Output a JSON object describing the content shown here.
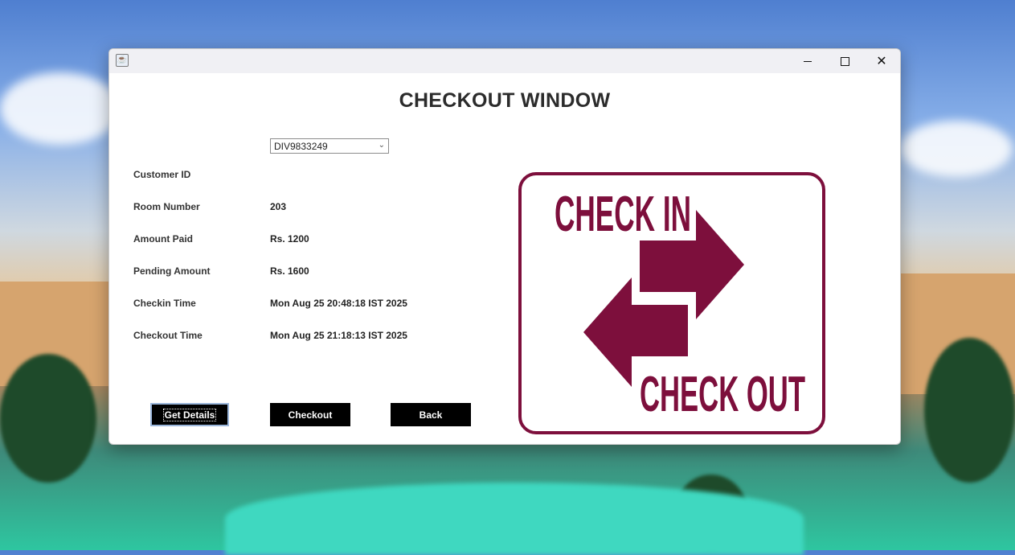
{
  "window": {
    "title": "",
    "controls": {
      "minimize": "minimize",
      "maximize": "maximize",
      "close": "✕"
    }
  },
  "form": {
    "heading": "CHECKOUT WINDOW",
    "customer_id": {
      "label": "Customer ID",
      "selected": "DIV9833249"
    },
    "fields": [
      {
        "label": "Room Number",
        "value": "203"
      },
      {
        "label": "Amount Paid",
        "value": "Rs. 1200"
      },
      {
        "label": "Pending Amount",
        "value": "Rs. 1600"
      },
      {
        "label": "Checkin Time",
        "value": "Mon Aug 25 20:48:18 IST 2025"
      },
      {
        "label": "Checkout Time",
        "value": "Mon Aug 25 21:18:13 IST 2025"
      }
    ]
  },
  "buttons": {
    "get_details": "Get Details",
    "checkout": "Checkout",
    "back": "Back"
  },
  "sign": {
    "top_text": "CHECK IN",
    "bottom_text": "CHECK OUT",
    "color": "#7d0f3c"
  },
  "colors": {
    "button_bg": "#000000",
    "button_text": "#ffffff",
    "focus_border": "#9ab6da"
  },
  "icons": {
    "app_icon": "java-cup-icon",
    "dropdown": "chevron-down-icon"
  }
}
